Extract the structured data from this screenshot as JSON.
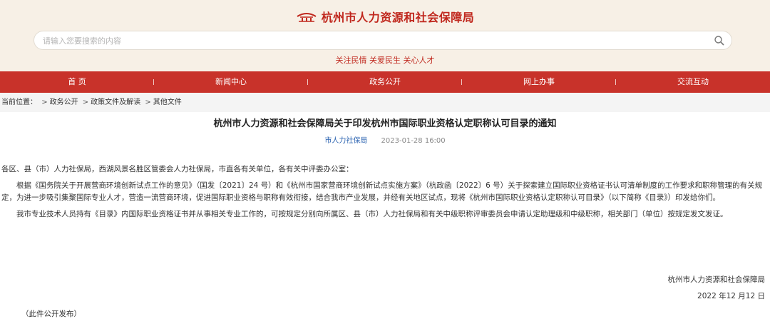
{
  "header": {
    "site_title": "杭州市人力资源和社会保障局",
    "slogan": "关注民情 关爱民生 关心人才"
  },
  "search": {
    "placeholder": "请输入您要搜索的内容",
    "value": ""
  },
  "nav": {
    "items": [
      "首 页",
      "新闻中心",
      "政务公开",
      "网上办事",
      "交流互动"
    ]
  },
  "breadcrumb": {
    "label": "当前位置：",
    "items": [
      "政务公开",
      "政策文件及解读",
      "其他文件"
    ]
  },
  "article": {
    "title": "杭州市人力资源和社会保障局关于印发杭州市国际职业资格认定职称认可目录的通知",
    "source": "市人力社保局",
    "date": "2023-01-28 16:00",
    "paragraphs": [
      "各区、县（市）人力社保局，西湖风景名胜区管委会人力社保局，市直各有关单位，各有关中评委办公室：",
      "根据《国务院关于开展营商环境创新试点工作的意见》（国发〔2021〕24 号）和《杭州市国家营商环境创新试点实施方案》（杭政函〔2022〕6 号）关于探索建立国际职业资格证书认可清单制度的工作要求和职称管理的有关规定，为进一步吸引集聚国际专业人才，营造一流营商环境，促进国际职业资格与职称有效衔接，结合我市产业发展，并经有关地区试点，现将《杭州市国际职业资格认定职称认可目录》（以下简称《目录》）印发给你们。",
      "",
      "我市专业技术人员持有《目录》内国际职业资格证书并从事相关专业工作的，可按规定分别向所属区、县（市）人力社保局和有关中级职称评审委员会申请认定助理级和中级职称，相关部门（单位）按规定发文发证。"
    ],
    "signature_org": "杭州市人力资源和社会保障局",
    "signature_date": "2022 年12 月12 日",
    "note": "（此件公开发布）"
  },
  "colors": {
    "brand_red": "#c0281e",
    "nav_red": "#c8322a",
    "header_bg": "#f7f0e6",
    "source_blue": "#2a62b0"
  },
  "icons": {
    "emblem": "city-emblem-icon",
    "search": "search-icon"
  }
}
